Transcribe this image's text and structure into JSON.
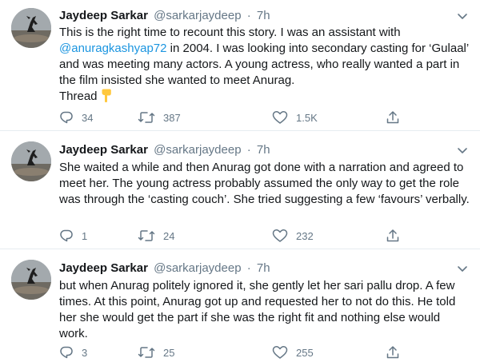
{
  "tweets": [
    {
      "author_name": "Jaydeep Sarkar",
      "handle": "@sarkarjaydeep",
      "separator": "·",
      "time": "7h",
      "text_before_mention": "This is the right time to recount this story. I was an assistant with ",
      "mention": "@anuragkashyap72",
      "text_after_mention": " in 2004. I was looking into secondary casting for ‘Gulaal’ and was meeting many actors. A young actress, who really wanted a part in the film insisted she wanted to meet Anurag.",
      "thread_label": "Thread",
      "thread_emoji": "pointing-down-emoji",
      "replies": "34",
      "retweets": "387",
      "likes": "1.5K"
    },
    {
      "author_name": "Jaydeep Sarkar",
      "handle": "@sarkarjaydeep",
      "separator": "·",
      "time": "7h",
      "text": "She waited a while and then Anurag got done with a narration and agreed to meet her. The young actress probably assumed the only way to get the role was through the ‘casting couch’. She tried suggesting a few ‘favours’ verbally.",
      "replies": "1",
      "retweets": "24",
      "likes": "232"
    },
    {
      "author_name": "Jaydeep Sarkar",
      "handle": "@sarkarjaydeep",
      "separator": "·",
      "time": "7h",
      "text": "but when Anurag politely ignored it, she gently let her sari pallu drop. A few times. At this point, Anurag got up and requested her to not do this. He told her she would get the part if she was the right fit and nothing else would work.",
      "replies": "3",
      "retweets": "25",
      "likes": "255"
    }
  ],
  "colors": {
    "text": "#14171a",
    "secondary": "#657786",
    "link": "#1b95e0",
    "divider": "#e6ecf0"
  }
}
